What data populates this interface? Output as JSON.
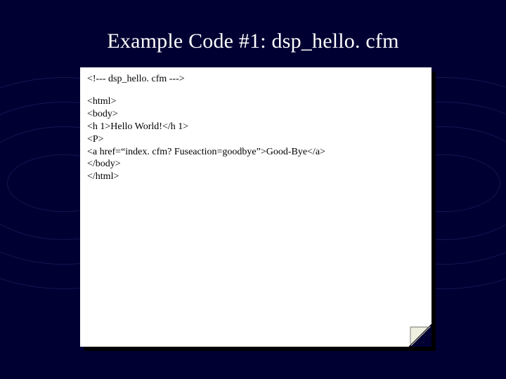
{
  "title": "Example Code #1: dsp_hello. cfm",
  "code": {
    "line1": "<!--- dsp_hello. cfm --->",
    "line2": "<html>",
    "line3": "<body>",
    "line4": "<h 1>Hello World!</h 1>",
    "line5": "<P>",
    "line6": "<a href=“index. cfm? Fuseaction=goodbye”>Good-Bye</a>",
    "line7": "</body>",
    "line8": "</html>"
  }
}
